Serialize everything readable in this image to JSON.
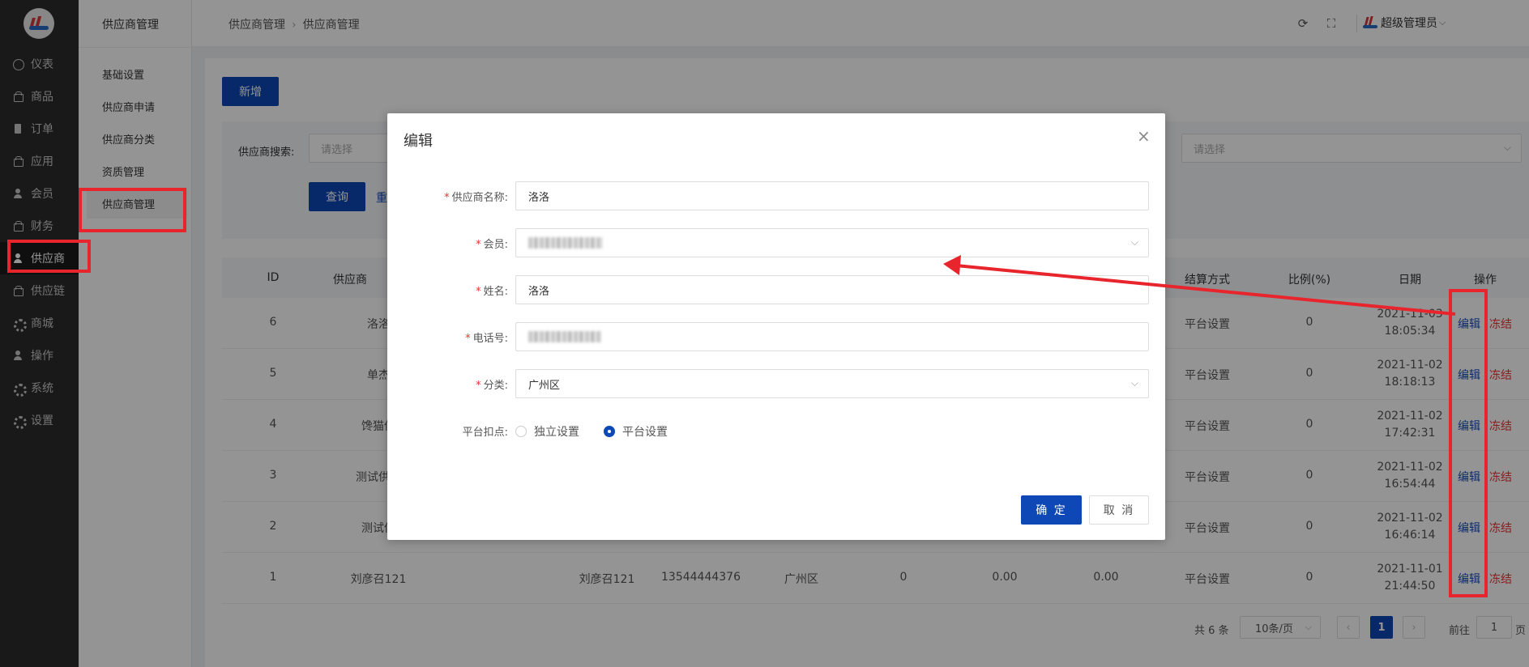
{
  "sidebar": {
    "items": [
      {
        "label": "仪表",
        "icon": "dashboard-icon"
      },
      {
        "label": "商品",
        "icon": "bag-icon"
      },
      {
        "label": "订单",
        "icon": "document-icon"
      },
      {
        "label": "应用",
        "icon": "bag-icon"
      },
      {
        "label": "会员",
        "icon": "person-icon"
      },
      {
        "label": "财务",
        "icon": "bag-icon"
      },
      {
        "label": "供应商",
        "icon": "person-icon"
      },
      {
        "label": "供应链",
        "icon": "bag-icon"
      },
      {
        "label": "商城",
        "icon": "gear-icon"
      },
      {
        "label": "操作",
        "icon": "person-icon"
      },
      {
        "label": "系统",
        "icon": "gear-icon"
      },
      {
        "label": "设置",
        "icon": "gear-icon"
      }
    ],
    "active": "供应商"
  },
  "subnav": {
    "title": "供应商管理",
    "items": [
      "基础设置",
      "供应商申请",
      "供应商分类",
      "资质管理",
      "供应商管理"
    ],
    "active": "供应商管理"
  },
  "header": {
    "breadcrumb": [
      "供应商管理",
      "供应商管理"
    ],
    "user": "超级管理员"
  },
  "toolbar": {
    "add_label": "新增"
  },
  "search": {
    "label": "供应商搜索:",
    "placeholder_1": "请选择",
    "placeholder_2": "请选择",
    "query_label": "查询",
    "reset_label": "重"
  },
  "table": {
    "headers": [
      "ID",
      "供应商",
      "结算方式",
      "比例(%)",
      "日期",
      "操作"
    ],
    "rows": [
      {
        "id": "6",
        "name": "洛洛",
        "settle": "平台设置",
        "ratio": "0",
        "date": "2021-11-03 18:05:34"
      },
      {
        "id": "5",
        "name": "单杰",
        "settle": "平台设置",
        "ratio": "0",
        "date": "2021-11-02 18:18:13"
      },
      {
        "id": "4",
        "name": "馋猫供",
        "settle": "平台设置",
        "ratio": "0",
        "date": "2021-11-02 17:42:31"
      },
      {
        "id": "3",
        "name": "测试供应",
        "settle": "平台设置",
        "ratio": "0",
        "date": "2021-11-02 16:54:44"
      },
      {
        "id": "2",
        "name": "测试供",
        "settle": "平台设置",
        "ratio": "0",
        "date": "2021-11-02 16:46:14"
      },
      {
        "id": "1",
        "name": "刘彦召121",
        "contact": "刘彦召121",
        "phone": "13544444376",
        "category": "广州区",
        "c1": "0",
        "c2": "0.00",
        "c3": "0.00",
        "settle": "平台设置",
        "ratio": "0",
        "date": "2021-11-01 21:44:50"
      }
    ],
    "edit_label": "编辑",
    "freeze_label": "冻结"
  },
  "pagination": {
    "total": "共 6 条",
    "page_size": "10条/页",
    "current": "1",
    "goto_prefix": "前往",
    "goto_value": "1",
    "goto_suffix": "页"
  },
  "modal": {
    "title": "编辑",
    "fields": {
      "name_label": "供应商名称:",
      "name_value": "洛洛",
      "member_label": "会员:",
      "realname_label": "姓名:",
      "realname_value": "洛洛",
      "phone_label": "电话号:",
      "category_label": "分类:",
      "category_value": "广州区",
      "deduct_label": "平台扣点:"
    },
    "radio_options": [
      "独立设置",
      "平台设置"
    ],
    "radio_selected": "平台设置",
    "ok_label": "确 定",
    "cancel_label": "取 消"
  },
  "colors": {
    "primary": "#0d48b6",
    "annotation": "#e8242c",
    "danger": "#e33333"
  }
}
